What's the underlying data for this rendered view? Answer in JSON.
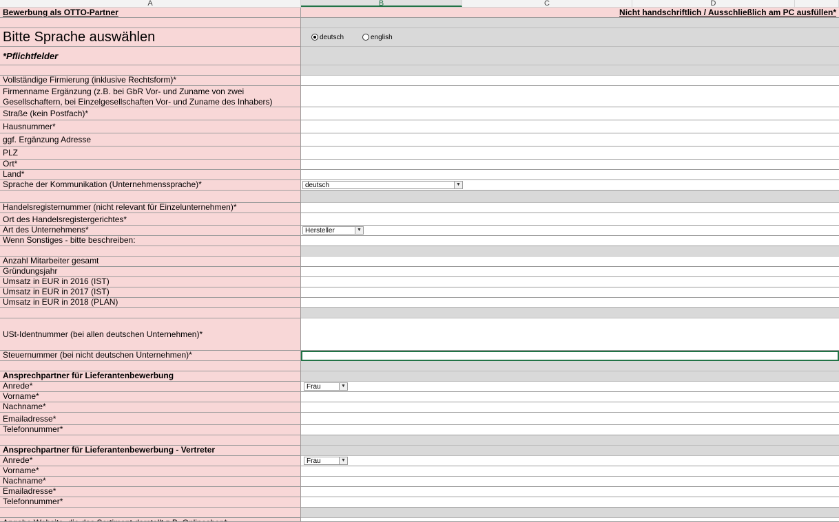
{
  "columns": [
    "A",
    "B",
    "C",
    "D"
  ],
  "header_left": "Bewerbung als OTTO-Partner",
  "header_right": "Nicht handschriftlich / Ausschließlich am PC ausfüllen*",
  "language_title": "Bitte Sprache auswählen",
  "radio_deutsch": "deutsch",
  "radio_english": "english",
  "pflicht": "*Pflichtfelder",
  "rows": {
    "firmierung": "Vollständige Firmierung (inklusive Rechtsform)*",
    "firmenname_ergaenzung": "Firmenname Ergänzung (z.B. bei GbR Vor- und Zuname von zwei Gesellschaftern, bei Einzelgesellschaften Vor- und Zuname des Inhabers)",
    "strasse": "Straße (kein Postfach)*",
    "hausnummer": "Hausnummer*",
    "ergaenzung_adresse": "ggf. Ergänzung Adresse",
    "plz": "PLZ",
    "ort": "Ort*",
    "land": "Land*",
    "sprache": "Sprache der Kommunikation (Unternehmenssprache)*",
    "handelsregisternummer": "Handelsregisternummer (nicht relevant für Einzelunternehmen)*",
    "ort_handelsregister": "Ort des Handelsregistergerichtes*",
    "art_unternehmen": "Art des Unternehmens*",
    "sonstiges": "Wenn Sonstiges - bitte beschreiben:",
    "mitarbeiter": "Anzahl Mitarbeiter gesamt",
    "gruendungsjahr": "Gründungsjahr",
    "umsatz2016": "Umsatz in EUR in 2016 (IST)",
    "umsatz2017": "Umsatz in EUR in 2017 (IST)",
    "umsatz2018": "Umsatz in EUR in 2018 (PLAN)",
    "ust": "USt-Identnummer (bei allen deutschen Unternehmen)*",
    "steuernummer": "Steuernummer (bei nicht deutschen Unternehmen)*",
    "ansprech_title": "Ansprechpartner für Lieferantenbewerbung",
    "anrede": "Anrede*",
    "vorname": "Vorname*",
    "nachname": "Nachname*",
    "email": "Emailadresse*",
    "telefon": "Telefonnummer*",
    "vertreter_title": "Ansprechpartner für Lieferantenbewerbung - Vertreter",
    "anrede2": "Anrede*",
    "vorname2": "Vorname*",
    "nachname2": "Nachname*",
    "email2": "Emailadresse*",
    "telefon2": "Telefonnummer*",
    "website": "Angabe Website, die das Sortiment darstellt z.B. Onlineshop*"
  },
  "dropdowns": {
    "sprache_value": "deutsch",
    "art_value": "Hersteller",
    "anrede_value": "Frau",
    "anrede2_value": "Frau"
  },
  "colors": {
    "pink": "#f8d7d7",
    "gray": "#d9d9d9",
    "excel_green": "#217346"
  }
}
